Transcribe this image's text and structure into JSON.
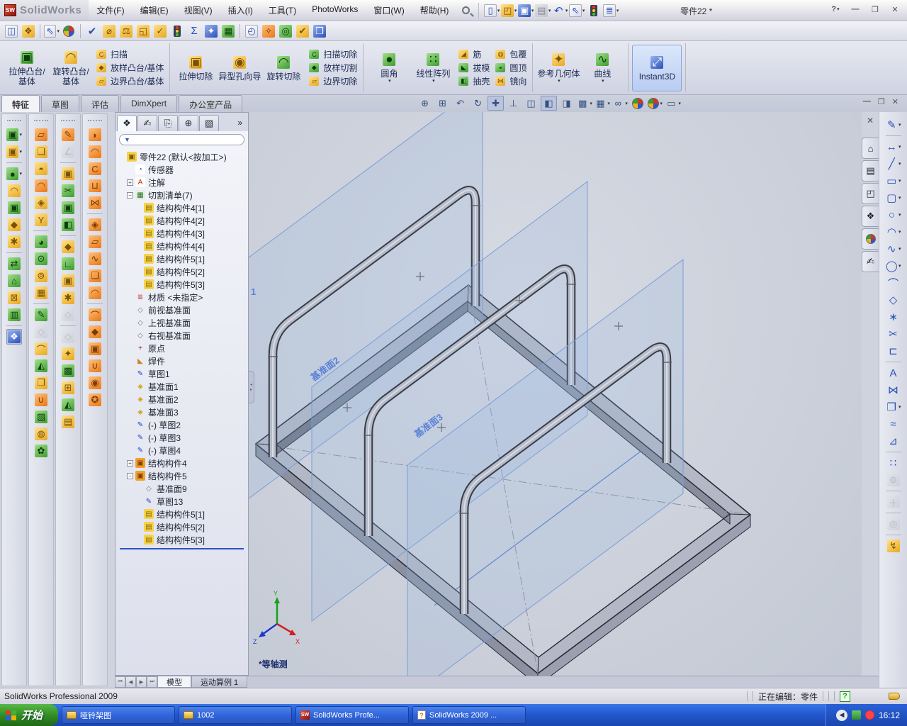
{
  "window": {
    "app_name": "SolidWorks",
    "logo_glyph": "SW",
    "doc_title": "零件22 *",
    "help_button": "?",
    "minimize_glyph": "—",
    "restore_glyph": "❐",
    "close_glyph": "✕"
  },
  "menubar": {
    "items": [
      "文件(F)",
      "编辑(E)",
      "视图(V)",
      "插入(I)",
      "工具(T)",
      "PhotoWorks",
      "窗口(W)",
      "帮助(H)"
    ]
  },
  "std_toolbar": [
    {
      "n": "new-document-button",
      "g": "▯",
      "c": "c-w",
      "d": true
    },
    {
      "n": "open-document-button",
      "g": "◰",
      "c": "c-y",
      "d": true
    },
    {
      "n": "save-button",
      "g": "▣",
      "c": "c-b",
      "d": true
    },
    {
      "n": "print-button",
      "g": "▤",
      "c": "c-x",
      "d": true
    },
    {
      "n": "undo-button",
      "g": "↶",
      "c": "c-n",
      "d": true
    },
    {
      "n": "select-cursor-button",
      "g": "⇖",
      "c": "c-w",
      "d": true
    },
    {
      "n": "rebuild-button",
      "g": "traffic",
      "c": "",
      "d": false
    },
    {
      "n": "options-button",
      "g": "≣",
      "c": "c-w",
      "d": true
    }
  ],
  "toolbar2": [
    {
      "n": "toggle-panes-button",
      "g": "◫",
      "c": "c-w"
    },
    {
      "n": "show-display-pane-button",
      "g": "❖",
      "c": "c-y"
    },
    {
      "n": "sep"
    },
    {
      "n": "select-button",
      "g": "⇖",
      "c": "c-w",
      "d": true
    },
    {
      "n": "render-ball-button",
      "g": "ball",
      "c": ""
    },
    {
      "n": "sep"
    },
    {
      "n": "spell-check-button",
      "g": "✔",
      "c": "c-n"
    },
    {
      "n": "measure-button",
      "g": "⌀",
      "c": "c-y"
    },
    {
      "n": "mass-properties-button",
      "g": "⚖",
      "c": "c-y"
    },
    {
      "n": "section-properties-button",
      "g": "◱",
      "c": "c-y"
    },
    {
      "n": "check-entity-button",
      "g": "✓",
      "c": "c-y"
    },
    {
      "n": "design-checker-button",
      "g": "traffic",
      "c": ""
    },
    {
      "n": "equations-button",
      "g": "Σ",
      "c": "c-n"
    },
    {
      "n": "deviation-analysis-button",
      "g": "✦",
      "c": "c-b"
    },
    {
      "n": "statistics-button",
      "g": "▦",
      "c": "c-g"
    },
    {
      "n": "sep"
    },
    {
      "n": "performance-button",
      "g": "◴",
      "c": "c-w"
    },
    {
      "n": "photoworks-button",
      "g": "✧",
      "c": "c-o"
    },
    {
      "n": "render-rings-button",
      "g": "◎",
      "c": "c-g"
    },
    {
      "n": "verify-button",
      "g": "✔",
      "c": "c-y"
    },
    {
      "n": "compare-button",
      "g": "❒",
      "c": "c-b"
    }
  ],
  "ribbon": {
    "groups": [
      {
        "items": [
          {
            "type": "big",
            "label": "拉伸凸台/基体",
            "g": "▣",
            "c": "c-g"
          },
          {
            "type": "big",
            "label": "旋转凸台/基体",
            "g": "◠",
            "c": "c-y"
          },
          {
            "type": "stack",
            "items": [
              {
                "label": "扫描",
                "g": "C",
                "c": "c-y"
              },
              {
                "label": "放样凸台/基体",
                "g": "◆",
                "c": "c-y"
              },
              {
                "label": "边界凸台/基体",
                "g": "▱",
                "c": "c-y"
              }
            ]
          }
        ]
      },
      {
        "items": [
          {
            "type": "big",
            "label": "拉伸切除",
            "g": "▣",
            "c": "c-y"
          },
          {
            "type": "big",
            "label": "异型孔向导",
            "g": "◉",
            "c": "c-y"
          },
          {
            "type": "big",
            "label": "旋转切除",
            "g": "◠",
            "c": "c-g"
          },
          {
            "type": "stack",
            "items": [
              {
                "label": "扫描切除",
                "g": "C",
                "c": "c-g"
              },
              {
                "label": "放样切割",
                "g": "◆",
                "c": "c-g"
              },
              {
                "label": "边界切除",
                "g": "▱",
                "c": "c-y"
              }
            ]
          }
        ]
      },
      {
        "items": [
          {
            "type": "big",
            "label": "圆角",
            "g": "●",
            "c": "c-g",
            "dd": true
          },
          {
            "type": "big",
            "label": "线性阵列",
            "g": "∷",
            "c": "c-g",
            "dd": true
          },
          {
            "type": "stack",
            "items": [
              {
                "label": "筋",
                "g": "◢",
                "c": "c-y"
              },
              {
                "label": "拔模",
                "g": "◣",
                "c": "c-g"
              },
              {
                "label": "抽壳",
                "g": "◧",
                "c": "c-g"
              }
            ]
          },
          {
            "type": "stack",
            "items": [
              {
                "label": "包覆",
                "g": "◍",
                "c": "c-y"
              },
              {
                "label": "圆顶",
                "g": "◓",
                "c": "c-g"
              },
              {
                "label": "镜向",
                "g": "⋈",
                "c": "c-y"
              }
            ]
          }
        ]
      },
      {
        "items": [
          {
            "type": "big",
            "label": "参考几何体",
            "g": "✦",
            "c": "c-y",
            "dd": true
          },
          {
            "type": "big",
            "label": "曲线",
            "g": "∿",
            "c": "c-g",
            "dd": true
          }
        ]
      },
      {
        "items": [
          {
            "type": "big",
            "label": "Instant3D",
            "g": "⤢",
            "c": "c-b",
            "pressed": true
          }
        ]
      }
    ]
  },
  "cm_tabs": [
    {
      "label": "特征",
      "active": true
    },
    {
      "label": "草图",
      "active": false
    },
    {
      "label": "评估",
      "active": false
    },
    {
      "label": "DimXpert",
      "active": false
    },
    {
      "label": "办公室产品",
      "active": false
    }
  ],
  "headsup": [
    {
      "n": "zoom-to-fit-button",
      "g": "⊕"
    },
    {
      "n": "zoom-to-area-button",
      "g": "⊞"
    },
    {
      "n": "previous-view-button",
      "g": "↶"
    },
    {
      "n": "rotate-view-button",
      "g": "↻"
    },
    {
      "n": "pan-button",
      "g": "✚",
      "pressed": true
    },
    {
      "n": "normal-to-button",
      "g": "⊥"
    },
    {
      "n": "section-view-button",
      "g": "◫"
    },
    {
      "n": "shaded-with-edges-button",
      "g": "◧",
      "pressed": true
    },
    {
      "n": "display-style-button",
      "g": "◨"
    },
    {
      "n": "edit-scene-button",
      "g": "▩",
      "d": true
    },
    {
      "n": "view-orientation-button",
      "g": "▦",
      "d": true
    },
    {
      "n": "hide-show-items-button",
      "g": "∞",
      "d": true
    },
    {
      "n": "appearances-button",
      "g": "ball"
    },
    {
      "n": "apply-scene-button",
      "g": "ball",
      "d": true
    },
    {
      "n": "view-settings-button",
      "g": "▭",
      "d": true
    }
  ],
  "left_toolbars": {
    "col1": [
      "▣|c-g|d",
      "▣|c-y|d",
      "●|c-g|ds",
      "◠|c-y|",
      "▣|c-g|",
      "◆|c-y|",
      "✱|c-y|",
      "⇄|c-g|s",
      "⌂|c-g|",
      "⊠|c-y|",
      "▥|c-g|",
      "❖|c-b|ps"
    ],
    "col2": [
      "▱|c-o|",
      "❏|c-y|",
      "◓|c-y|",
      "◠|c-o|",
      "◈|c-y|",
      "Y|c-y|",
      "◕|c-g|s",
      "⊙|c-g|",
      "⊚|c-y|",
      "▦|c-y|",
      "✎|c-g|s",
      "◇|c-x|x",
      "⌒|c-y|",
      "◭|c-g|",
      "❒|c-y|",
      "∪|c-o|",
      "▧|c-g|",
      "◍|c-y|",
      "✿|c-g|"
    ],
    "col3": [
      "✎|c-o|",
      "∠|c-x|x",
      "▣|c-y|s",
      "✂|c-g|",
      "▣|c-g|",
      "◧|c-g|",
      "◆|c-y|s",
      "∟|c-g|",
      "▣|c-y|",
      "✱|c-y|",
      "◇|c-x|x",
      "◇|c-x|xs",
      "✦|c-y|",
      "▩|c-g|",
      "⊞|c-y|",
      "◭|c-g|",
      "▤|c-y|"
    ],
    "col4": [
      "◗|c-o|",
      "◠|c-o|",
      "C|c-o|",
      "⊔|c-o|",
      "⋈|c-o|",
      "◈|c-o|s",
      "▱|c-o|",
      "∿|c-o|",
      "❏|c-o|",
      "◠|c-o|",
      "⌒|c-o|s",
      "◆|c-o|",
      "▣|c-o|",
      "∪|c-o|",
      "◉|c-o|",
      "✪|c-o|"
    ]
  },
  "tree_panel": {
    "tabs": [
      {
        "n": "featuremanager-tab",
        "g": "❖",
        "active": true
      },
      {
        "n": "propertymanager-tab",
        "g": "✍",
        "active": false
      },
      {
        "n": "configurationmanager-tab",
        "g": "⎘",
        "active": false
      },
      {
        "n": "dimxpertmanager-tab",
        "g": "⊕",
        "active": false
      },
      {
        "n": "displaymanager-tab",
        "g": "▧",
        "active": false
      }
    ],
    "overflow_glyph": "»",
    "filter_glyph": "▼",
    "nodes": [
      {
        "label": "零件22  (默认<按加工>)",
        "icon": "part",
        "lvl": 0,
        "exp": ""
      },
      {
        "label": "传感器",
        "icon": "sensor",
        "lvl": 1,
        "exp": ""
      },
      {
        "label": "注解",
        "icon": "ann",
        "lvl": 1,
        "exp": "+"
      },
      {
        "label": "切割清单(7)",
        "icon": "cutlist",
        "lvl": 1,
        "exp": "-"
      },
      {
        "label": "结构构件4[1]",
        "icon": "cube",
        "lvl": 2,
        "exp": ""
      },
      {
        "label": "结构构件4[2]",
        "icon": "cube",
        "lvl": 2,
        "exp": ""
      },
      {
        "label": "结构构件4[3]",
        "icon": "cube",
        "lvl": 2,
        "exp": ""
      },
      {
        "label": "结构构件4[4]",
        "icon": "cube",
        "lvl": 2,
        "exp": ""
      },
      {
        "label": "结构构件5[1]",
        "icon": "cube",
        "lvl": 2,
        "exp": ""
      },
      {
        "label": "结构构件5[2]",
        "icon": "cube",
        "lvl": 2,
        "exp": ""
      },
      {
        "label": "结构构件5[3]",
        "icon": "cube",
        "lvl": 2,
        "exp": ""
      },
      {
        "label": "材质 <未指定>",
        "icon": "mat",
        "lvl": 1,
        "exp": ""
      },
      {
        "label": "前视基准面",
        "icon": "plane",
        "lvl": 1,
        "exp": ""
      },
      {
        "label": "上视基准面",
        "icon": "plane",
        "lvl": 1,
        "exp": ""
      },
      {
        "label": "右视基准面",
        "icon": "plane",
        "lvl": 1,
        "exp": ""
      },
      {
        "label": "原点",
        "icon": "origin",
        "lvl": 1,
        "exp": ""
      },
      {
        "label": "焊件",
        "icon": "weld",
        "lvl": 1,
        "exp": ""
      },
      {
        "label": "草图1",
        "icon": "sketch",
        "lvl": 1,
        "exp": ""
      },
      {
        "label": "基准面1",
        "icon": "planeY",
        "lvl": 1,
        "exp": ""
      },
      {
        "label": "基准面2",
        "icon": "planeY",
        "lvl": 1,
        "exp": ""
      },
      {
        "label": "基准面3",
        "icon": "planeY",
        "lvl": 1,
        "exp": ""
      },
      {
        "label": "(-) 草图2",
        "icon": "sketch",
        "lvl": 1,
        "exp": ""
      },
      {
        "label": "(-) 草图3",
        "icon": "sketch",
        "lvl": 1,
        "exp": ""
      },
      {
        "label": "(-) 草图4",
        "icon": "sketch",
        "lvl": 1,
        "exp": ""
      },
      {
        "label": "结构构件4",
        "icon": "struct",
        "lvl": 1,
        "exp": "+"
      },
      {
        "label": "结构构件5",
        "icon": "struct",
        "lvl": 1,
        "exp": "-"
      },
      {
        "label": "基准面9",
        "icon": "plane",
        "lvl": 2,
        "exp": ""
      },
      {
        "label": "草图13",
        "icon": "sketch",
        "lvl": 2,
        "exp": ""
      },
      {
        "label": "结构构件5[1]",
        "icon": "cube",
        "lvl": 2,
        "exp": ""
      },
      {
        "label": "结构构件5[2]",
        "icon": "cube",
        "lvl": 2,
        "exp": ""
      },
      {
        "label": "结构构件5[3]",
        "icon": "cube",
        "lvl": 2,
        "exp": ""
      }
    ]
  },
  "viewport": {
    "plane2_label": "基准面2",
    "plane3_label": "基准面3",
    "plane1_label": "1",
    "annotation": "*等轴测",
    "triad": {
      "x": "X",
      "y": "Y",
      "z": "Z"
    }
  },
  "taskpane": {
    "close_glyph": "✕",
    "tabs": [
      {
        "n": "solidworks-resources-tab",
        "g": "⌂"
      },
      {
        "n": "design-library-tab",
        "g": "▤"
      },
      {
        "n": "file-explorer-tab",
        "g": "◰"
      },
      {
        "n": "view-palette-tab",
        "g": "❖"
      },
      {
        "n": "appearances-scenes-tab",
        "g": "ball"
      },
      {
        "n": "custom-properties-tab",
        "g": "✍"
      }
    ]
  },
  "right_toolbar": [
    {
      "n": "sketch-button",
      "g": "✎",
      "c": "c-n",
      "d": true
    },
    {
      "n": "smart-dimension-button",
      "g": "↔",
      "c": "c-n",
      "d": true,
      "s": true
    },
    {
      "n": "line-button",
      "g": "╱",
      "c": "c-n",
      "d": true
    },
    {
      "n": "rectangle-button",
      "g": "▭",
      "c": "c-n",
      "d": true
    },
    {
      "n": "slot-button",
      "g": "▢",
      "c": "c-n",
      "d": true
    },
    {
      "n": "circle-button",
      "g": "○",
      "c": "c-n",
      "d": true
    },
    {
      "n": "arc-button",
      "g": "◠",
      "c": "c-n",
      "d": true
    },
    {
      "n": "spline-button",
      "g": "∿",
      "c": "c-n",
      "d": true
    },
    {
      "n": "ellipse-button",
      "g": "◯",
      "c": "c-n",
      "d": true
    },
    {
      "n": "sketch-fillet-button",
      "g": "⌒",
      "c": "c-n"
    },
    {
      "n": "polygon-button",
      "g": "◇",
      "c": "c-n"
    },
    {
      "n": "point-button",
      "g": "∗",
      "c": "c-n"
    },
    {
      "n": "trim-entities-button",
      "g": "✂",
      "c": "c-n"
    },
    {
      "n": "convert-entities-button",
      "g": "⊏",
      "c": "c-n"
    },
    {
      "n": "sketch-text-button",
      "g": "A",
      "c": "c-n",
      "s": true
    },
    {
      "n": "mirror-entities-button",
      "g": "⋈",
      "c": "c-n"
    },
    {
      "n": "linear-sketch-pattern-button",
      "g": "❒",
      "c": "c-n",
      "d": true
    },
    {
      "n": "offset-entities-button",
      "g": "≈",
      "c": "c-n"
    },
    {
      "n": "move-entities-button",
      "g": "⊿",
      "c": "c-n"
    },
    {
      "n": "sketch-pattern2-button",
      "g": "∷",
      "c": "c-n",
      "s": true
    },
    {
      "n": "display-relations-button",
      "g": "⊚",
      "c": "c-x",
      "x": true
    },
    {
      "n": "add-relation-button",
      "g": "＋",
      "c": "c-x",
      "x": true,
      "s": true
    },
    {
      "n": "rapid-sketch-button",
      "g": "◎",
      "c": "c-x",
      "x": true,
      "s": true
    },
    {
      "n": "block-button",
      "g": "↯",
      "c": "c-y",
      "s": true
    }
  ],
  "bottom_tabs": {
    "nav": [
      "⏮",
      "◀",
      "▶",
      "⏭"
    ],
    "tabs": [
      {
        "label": "模型",
        "active": true
      },
      {
        "label": "运动算例 1",
        "active": false
      }
    ]
  },
  "statusbar": {
    "left": "SolidWorks Professional 2009",
    "editing": "正在编辑：零件",
    "help_glyph": "?"
  },
  "taskbar": {
    "start_label": "开始",
    "buttons": [
      {
        "label": "哑铃架图",
        "icon": "folder"
      },
      {
        "label": "1002",
        "icon": "folder"
      },
      {
        "label": "SolidWorks Profe...",
        "icon": "sw"
      },
      {
        "label": "SolidWorks 2009 ...",
        "icon": "help"
      }
    ],
    "tray_chevron": "◀",
    "clock": "16:12"
  },
  "colors": {
    "taskbar_blue": "#2258d0",
    "start_green": "#2f8a22",
    "plane_blue": "#7d9cd8",
    "tube_gray": "#b5bbc8",
    "edge_dark": "#383d49"
  }
}
